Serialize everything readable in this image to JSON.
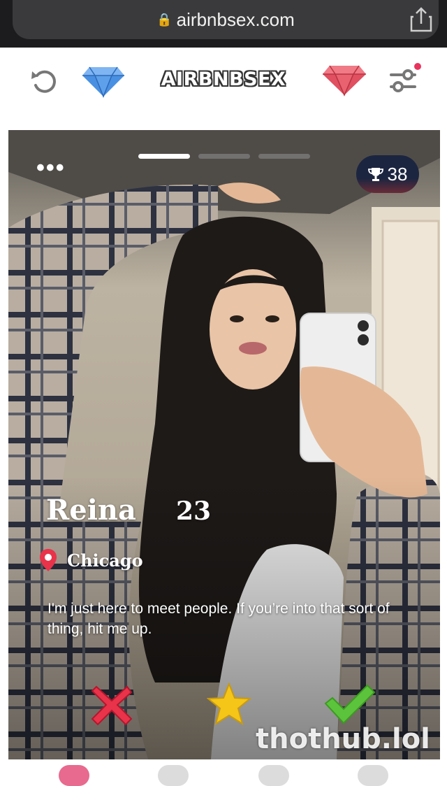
{
  "browser": {
    "url": "airbnbsex.com"
  },
  "header": {
    "logo": "AIRBNBSEX",
    "icons": [
      "undo-icon",
      "blue-diamond-icon",
      "red-diamond-icon",
      "filter-icon"
    ],
    "colors": {
      "blue_gem": "#4a90e2",
      "red_gem": "#e05060",
      "notification_dot": "#e8335d"
    }
  },
  "profile": {
    "name": "Reina",
    "age": "23",
    "location": "Chicago",
    "bio": "I'm just here to meet people. If you’re into that sort of thing, hit me up.",
    "trophy_count": "38",
    "photo_index": 1,
    "photo_total": 3
  },
  "actions": [
    {
      "name": "reject",
      "icon": "x-icon",
      "color": "#e8334a"
    },
    {
      "name": "super-like",
      "icon": "star-icon",
      "color": "#f5c518"
    },
    {
      "name": "like",
      "icon": "check-icon",
      "color": "#5cc33c"
    }
  ],
  "watermark": "thothub.lol"
}
